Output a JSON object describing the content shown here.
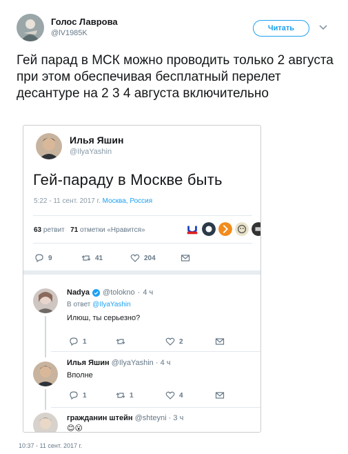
{
  "outer": {
    "author_name": "Голос Лаврова",
    "author_handle": "@lV1985K",
    "follow_label": "Читать",
    "text": "Гей парад в МСК можно проводить только 2 августа при этом обеспечивая бесплатный перелет десантуре на 2 3 4 августа включительно",
    "date": "10:37 - 11 сент. 2017 г."
  },
  "embedded": {
    "author_name": "Илья Яшин",
    "author_handle": "@IlyaYashin",
    "text": "Гей-параду в Москве быть",
    "time": "5:22 - 11 сент. 2017 г.",
    "location": "Москва, Россия",
    "retweets_count": "63",
    "retweets_label": "ретвит",
    "likes_count": "71",
    "likes_label": "отметки «Нравится»",
    "actions": {
      "replies": "9",
      "retweets": "41",
      "likes": "204"
    },
    "replies": [
      {
        "name": "Nadya",
        "handle": "@tolokno",
        "age": "4 ч",
        "in_reply_prefix": "В ответ",
        "in_reply_handle": "@IlyaYashin",
        "text": "Илюш, ты серьезно?",
        "actions": {
          "replies": "1",
          "retweets": "",
          "likes": "2"
        }
      },
      {
        "name": "Илья Яшин",
        "handle": "@IlyaYashin",
        "age": "4 ч",
        "text": "Вполне",
        "actions": {
          "replies": "1",
          "retweets": "1",
          "likes": "4"
        }
      },
      {
        "name": "гражданин штейн",
        "handle": "@shteyni",
        "age": "3 ч",
        "text": "😊😮"
      }
    ]
  },
  "colors": {
    "accent": "#1da1f2",
    "muted": "#657786",
    "divider": "#e1e8ed"
  },
  "icons": [
    "chevron-down-icon",
    "reply-icon",
    "retweet-icon",
    "like-icon",
    "mail-icon",
    "verified-icon"
  ]
}
